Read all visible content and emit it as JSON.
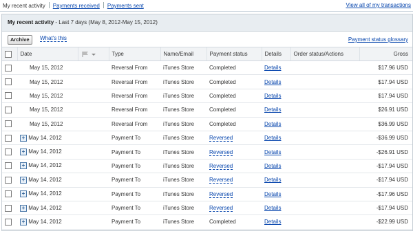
{
  "topnav": {
    "tabs": [
      "My recent activity",
      "Payments received",
      "Payments sent"
    ],
    "view_all": "View all of my transactions"
  },
  "header": {
    "title": "My recent activity",
    "subtitle": "- Last 7 days (May 8, 2012-May 15, 2012)"
  },
  "toolbar": {
    "archive_label": "Archive",
    "whats_this": "What's this",
    "glossary": "Payment status glossary"
  },
  "columns": [
    "Date",
    "Type",
    "Name/Email",
    "Payment status",
    "Details",
    "Order status/Actions",
    "Gross"
  ],
  "rows": [
    {
      "date": "May 15, 2012",
      "type": "Reversal From",
      "name": "iTunes Store",
      "status": "Completed",
      "details": "Details",
      "gross": "$17.96 USD"
    },
    {
      "date": "May 15, 2012",
      "type": "Reversal From",
      "name": "iTunes Store",
      "status": "Completed",
      "details": "Details",
      "gross": "$17.94 USD"
    },
    {
      "date": "May 15, 2012",
      "type": "Reversal From",
      "name": "iTunes Store",
      "status": "Completed",
      "details": "Details",
      "gross": "$17.94 USD"
    },
    {
      "date": "May 15, 2012",
      "type": "Reversal From",
      "name": "iTunes Store",
      "status": "Completed",
      "details": "Details",
      "gross": "$26.91 USD"
    },
    {
      "date": "May 15, 2012",
      "type": "Reversal From",
      "name": "iTunes Store",
      "status": "Completed",
      "details": "Details",
      "gross": "$36.99 USD"
    },
    {
      "date": "May 14, 2012",
      "type": "Payment To",
      "name": "iTunes Store",
      "status": "Reversed",
      "details": "Details",
      "gross": "-$36.99 USD"
    },
    {
      "date": "May 14, 2012",
      "type": "Payment To",
      "name": "iTunes Store",
      "status": "Reversed",
      "details": "Details",
      "gross": "-$26.91 USD"
    },
    {
      "date": "May 14, 2012",
      "type": "Payment To",
      "name": "iTunes Store",
      "status": "Reversed",
      "details": "Details",
      "gross": "-$17.94 USD"
    },
    {
      "date": "May 14, 2012",
      "type": "Payment To",
      "name": "iTunes Store",
      "status": "Reversed",
      "details": "Details",
      "gross": "-$17.94 USD"
    },
    {
      "date": "May 14, 2012",
      "type": "Payment To",
      "name": "iTunes Store",
      "status": "Reversed",
      "details": "Details",
      "gross": "-$17.96 USD"
    },
    {
      "date": "May 14, 2012",
      "type": "Payment To",
      "name": "iTunes Store",
      "status": "Reversed",
      "details": "Details",
      "gross": "-$17.94 USD"
    },
    {
      "date": "May 14, 2012",
      "type": "Payment To",
      "name": "iTunes Store",
      "status": "Completed",
      "details": "Details",
      "gross": "-$22.99 USD"
    }
  ]
}
